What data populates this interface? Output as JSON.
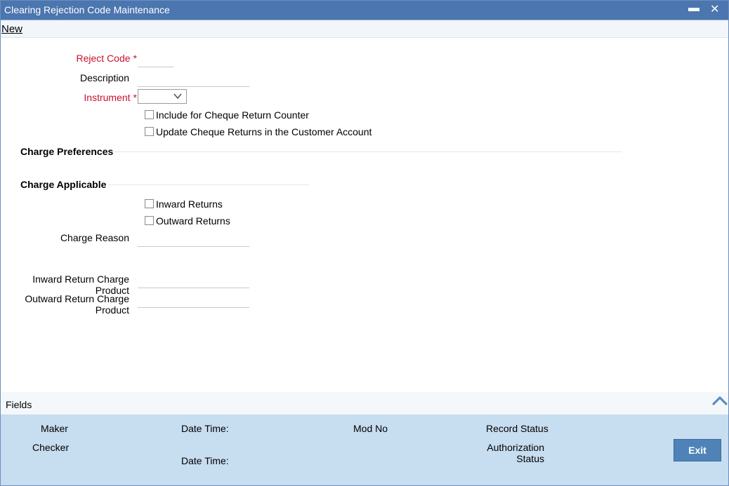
{
  "window": {
    "title": "Clearing Rejection Code Maintenance",
    "minimize_glyph": "▬",
    "close_glyph": "✕"
  },
  "toolbar": {
    "new_label": "New"
  },
  "form": {
    "reject_code_label": "Reject Code",
    "reject_code_value": "",
    "description_label": "Description",
    "description_value": "",
    "instrument_label": "Instrument",
    "instrument_value": "",
    "required_marker": "*",
    "include_cheque_return_counter": "Include for Cheque Return Counter",
    "update_cheque_returns": "Update Cheque Returns in the Customer Account",
    "charge_preferences": "Charge Preferences",
    "charge_applicable": "Charge Applicable",
    "inward_returns": "Inward Returns",
    "outward_returns": "Outward Returns",
    "charge_reason_label": "Charge Reason",
    "charge_reason_value": "",
    "inward_return_charge_product_label": "Inward Return Charge Product",
    "inward_return_charge_product_value": "",
    "outward_return_charge_product_label_1": "Outward Return Charge",
    "outward_return_charge_product_label_2": "Product",
    "outward_return_charge_product_value": ""
  },
  "fields_bar": {
    "label": "Fields"
  },
  "footer": {
    "maker": "Maker",
    "checker": "Checker",
    "date_time_1": "Date Time:",
    "date_time_2": "Date Time:",
    "mod_no": "Mod No",
    "record_status": "Record Status",
    "authorization_1": "Authorization",
    "authorization_2": "Status",
    "exit_label": "Exit"
  },
  "colors": {
    "titlebar": "#4b76af",
    "required": "#c8102e",
    "footer": "#c7ddf0",
    "exit_button": "#4f83b8"
  }
}
